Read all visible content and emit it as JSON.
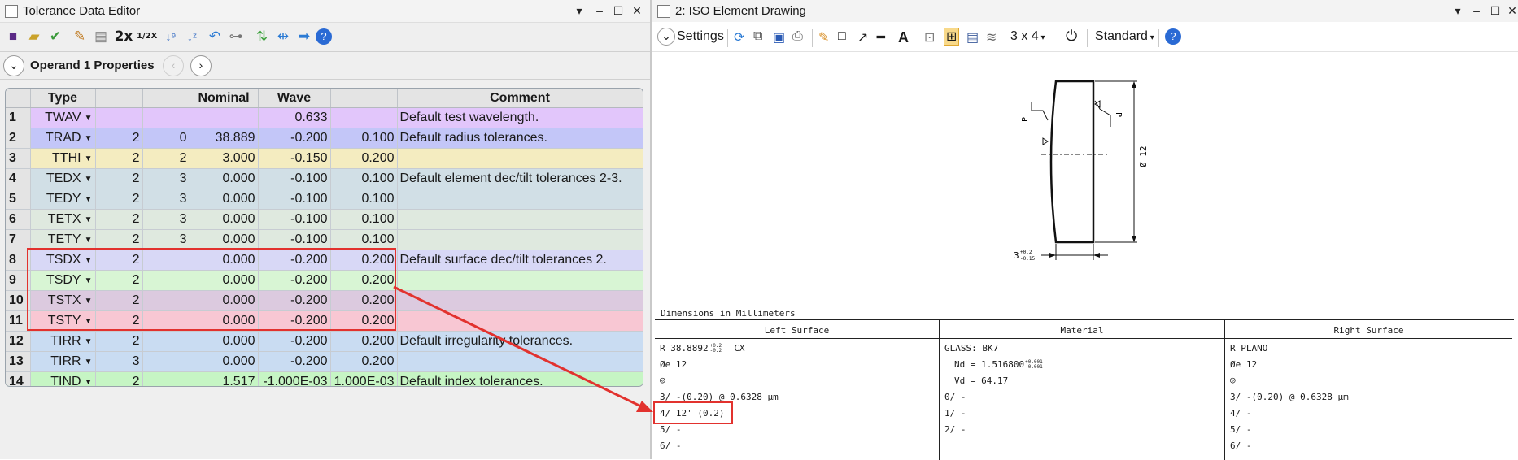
{
  "left_window": {
    "title": "Tolerance Data Editor",
    "operand_label": "Operand  1 Properties",
    "toolbar": {
      "zoom2x": "2x",
      "zoomhalf": "1/2X"
    },
    "columns": [
      "",
      "Type",
      "",
      "",
      "Nominal",
      "Wave",
      "",
      "Comment"
    ],
    "rows": [
      {
        "n": "1",
        "type": "TWAV",
        "c1": "",
        "c2": "",
        "nominal": "",
        "wave": "0.633",
        "c5": "",
        "comment": "Default test wavelength.",
        "bg": "#e2c6fb"
      },
      {
        "n": "2",
        "type": "TRAD",
        "c1": "2",
        "c2": "0",
        "nominal": "38.889",
        "wave": "-0.200",
        "c5": "0.100",
        "comment": "Default radius tolerances.",
        "bg": "#c3c6f8"
      },
      {
        "n": "3",
        "type": "TTHI",
        "c1": "2",
        "c2": "2",
        "nominal": "3.000",
        "wave": "-0.150",
        "c5": "0.200",
        "comment": "",
        "bg": "#f4ecc0"
      },
      {
        "n": "4",
        "type": "TEDX",
        "c1": "2",
        "c2": "3",
        "nominal": "0.000",
        "wave": "-0.100",
        "c5": "0.100",
        "comment": "Default element dec/tilt tolerances 2-3.",
        "bg": "#d1dfe6"
      },
      {
        "n": "5",
        "type": "TEDY",
        "c1": "2",
        "c2": "3",
        "nominal": "0.000",
        "wave": "-0.100",
        "c5": "0.100",
        "comment": "",
        "bg": "#d1dfe6"
      },
      {
        "n": "6",
        "type": "TETX",
        "c1": "2",
        "c2": "3",
        "nominal": "0.000",
        "wave": "-0.100",
        "c5": "0.100",
        "comment": "",
        "bg": "#dfe9df"
      },
      {
        "n": "7",
        "type": "TETY",
        "c1": "2",
        "c2": "3",
        "nominal": "0.000",
        "wave": "-0.100",
        "c5": "0.100",
        "comment": "",
        "bg": "#dfe9df"
      },
      {
        "n": "8",
        "type": "TSDX",
        "c1": "2",
        "c2": "",
        "nominal": "0.000",
        "wave": "-0.200",
        "c5": "0.200",
        "comment": "Default surface dec/tilt tolerances 2.",
        "bg": "#d8d8f6"
      },
      {
        "n": "9",
        "type": "TSDY",
        "c1": "2",
        "c2": "",
        "nominal": "0.000",
        "wave": "-0.200",
        "c5": "0.200",
        "comment": "",
        "bg": "#d8f5d4"
      },
      {
        "n": "10",
        "type": "TSTX",
        "c1": "2",
        "c2": "",
        "nominal": "0.000",
        "wave": "-0.200",
        "c5": "0.200",
        "comment": "",
        "bg": "#dccadf"
      },
      {
        "n": "11",
        "type": "TSTY",
        "c1": "2",
        "c2": "",
        "nominal": "0.000",
        "wave": "-0.200",
        "c5": "0.200",
        "comment": "",
        "bg": "#f8c7d3"
      },
      {
        "n": "12",
        "type": "TIRR",
        "c1": "2",
        "c2": "",
        "nominal": "0.000",
        "wave": "-0.200",
        "c5": "0.200",
        "comment": "Default irregularity tolerances.",
        "bg": "#c9dcf2"
      },
      {
        "n": "13",
        "type": "TIRR",
        "c1": "3",
        "c2": "",
        "nominal": "0.000",
        "wave": "-0.200",
        "c5": "0.200",
        "comment": "",
        "bg": "#c9dcf2"
      },
      {
        "n": "14",
        "type": "TIND",
        "c1": "2",
        "c2": "",
        "nominal": "1.517",
        "wave": "-1.000E-03",
        "c5": "1.000E-03",
        "comment": "Default index tolerances.",
        "bg": "#c6f5c4"
      }
    ]
  },
  "right_window": {
    "title": "2: ISO Element Drawing",
    "toolbar": {
      "settings": "Settings",
      "layout": "3 x 4",
      "style": "Standard"
    },
    "drawing": {
      "diameter_label": "Ø 12",
      "thickness_label": "3",
      "thickness_tol_plus": "+0.2",
      "thickness_tol_minus": "-0.15",
      "p_mark": "P"
    },
    "dimensions_note": "Dimensions in Millimeters",
    "spec_table": {
      "headers": [
        "Left Surface",
        "Material",
        "Right Surface"
      ],
      "left": [
        "R 38.8892",
        "Øe 12",
        "◎",
        "3/ -(0.20) @ 0.6328 μm",
        "4/ 12' (0.2)",
        "5/ -",
        "6/ -"
      ],
      "left_radius_tol_plus": "+0.2",
      "left_radius_tol_minus": "-0.2",
      "left_radius_suffix": "CX",
      "material": [
        "GLASS: BK7",
        "Nd = 1.516800",
        "Vd = 64.17",
        "0/ -",
        "1/ -",
        "2/ -"
      ],
      "material_nd_tol_plus": "+0.001",
      "material_nd_tol_minus": "-0.001",
      "right": [
        "R PLANO",
        "Øe 12",
        "◎",
        "3/ -(0.20) @ 0.6328 μm",
        "4/ -",
        "5/ -",
        "6/ -"
      ]
    }
  },
  "colors": {
    "highlight": "#e2322e",
    "title_bg": "#f3f3f3",
    "header_bg": "#e4e4e4"
  }
}
